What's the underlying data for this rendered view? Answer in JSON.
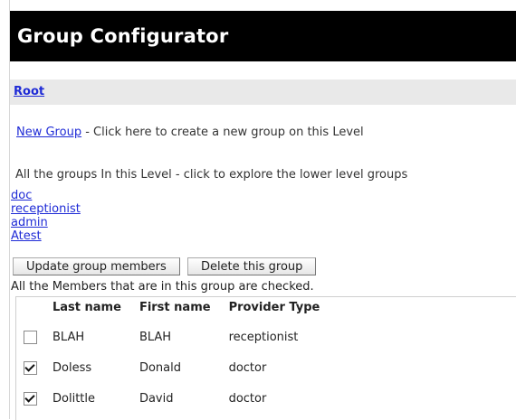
{
  "header": {
    "title": "Group Configurator"
  },
  "breadcrumb": {
    "root_label": "Root"
  },
  "new_group": {
    "link_label": "New Group",
    "description": " - Click here to create a new group on this Level"
  },
  "groups_section": {
    "intro": "All the groups In this Level - click to explore the lower level groups",
    "groups": [
      "doc",
      "receptionist",
      "admin",
      "Atest"
    ]
  },
  "actions": {
    "update_label": "Update group members",
    "delete_label": "Delete this group"
  },
  "members": {
    "note": "All the Members that are in this group are checked.",
    "columns": [
      "Last name",
      "First name",
      "Provider Type"
    ],
    "rows": [
      {
        "checked": false,
        "last": "BLAH",
        "first": "BLAH",
        "type": "receptionist"
      },
      {
        "checked": true,
        "last": "Doless",
        "first": "Donald",
        "type": "doctor"
      },
      {
        "checked": true,
        "last": "Dolittle",
        "first": "David",
        "type": "doctor"
      }
    ]
  },
  "colors": {
    "header_bg": "#000000",
    "link": "#1f2bd6",
    "crumb_bg": "#e9e9e9"
  }
}
